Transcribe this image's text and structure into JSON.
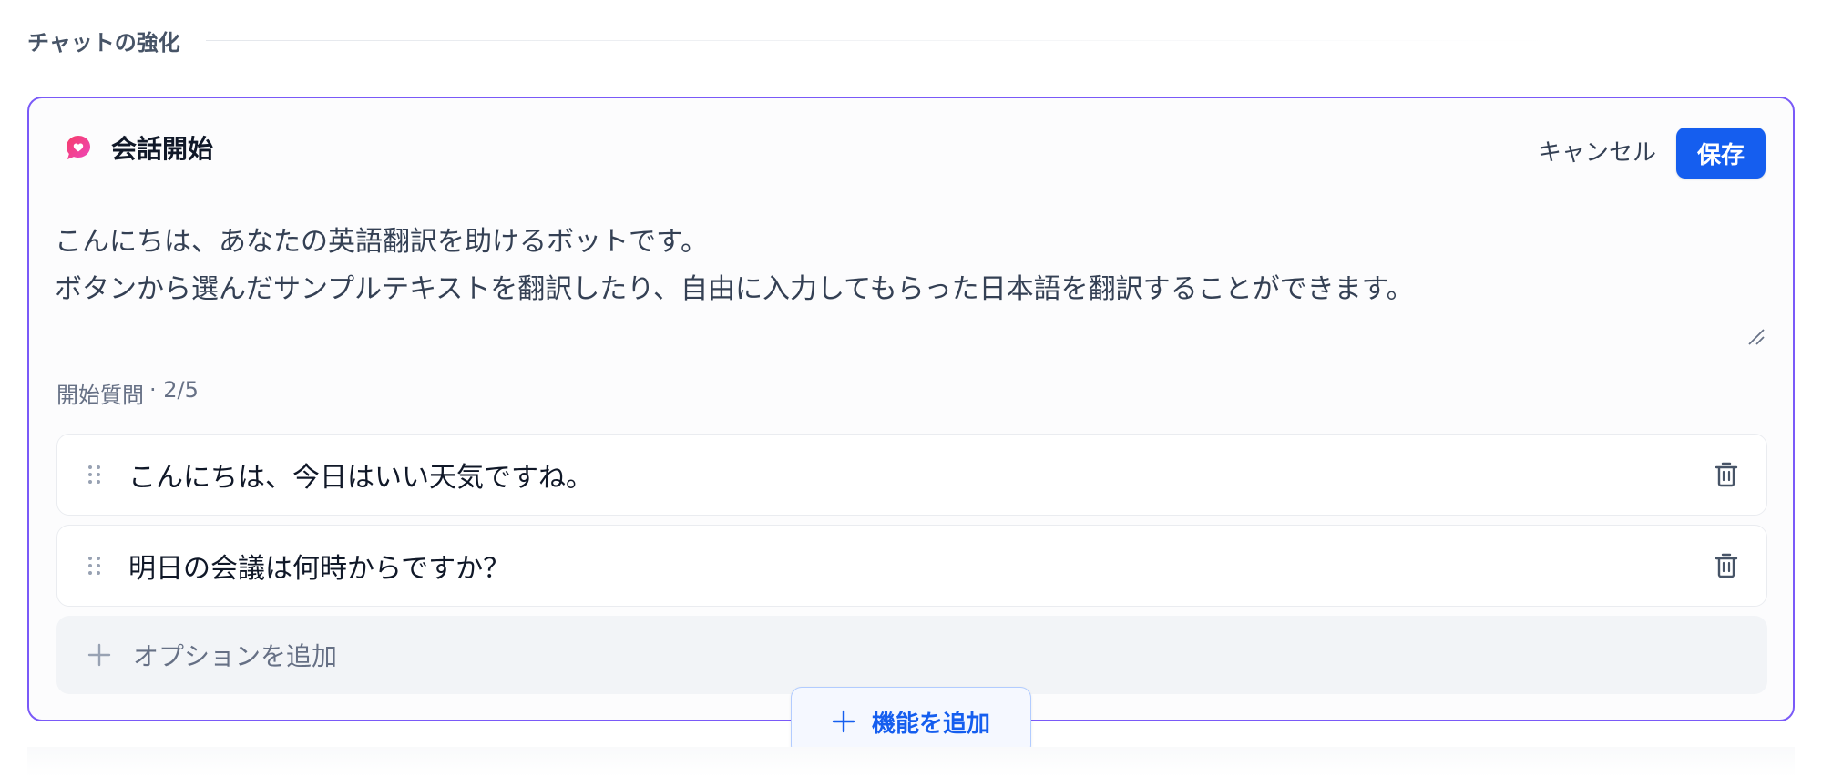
{
  "section": {
    "title": "チャットの強化"
  },
  "card": {
    "icon": "chat-bubble-icon",
    "title": "会話開始",
    "cancel_label": "キャンセル",
    "save_label": "保存",
    "accent_color": "#7a5af8",
    "save_color": "#155eef",
    "opening_message": [
      "こんにちは、あなたの英語翻訳を助けるボットです。",
      "ボタンから選んだサンプルテキストを翻訳したり、自由に入力してもらった日本語を翻訳することができます。"
    ],
    "questions_label": "開始質問",
    "questions_count": "· 2/5",
    "questions": [
      {
        "text": "こんにちは、今日はいい天気ですね。",
        "drag_icon": "drag-handle-icon",
        "delete_icon": "trash-icon"
      },
      {
        "text": "明日の会議は何時からですか？",
        "drag_icon": "drag-handle-icon",
        "delete_icon": "trash-icon"
      }
    ],
    "add_option_label": "オプションを追加"
  },
  "add_feature_label": "機能を追加"
}
